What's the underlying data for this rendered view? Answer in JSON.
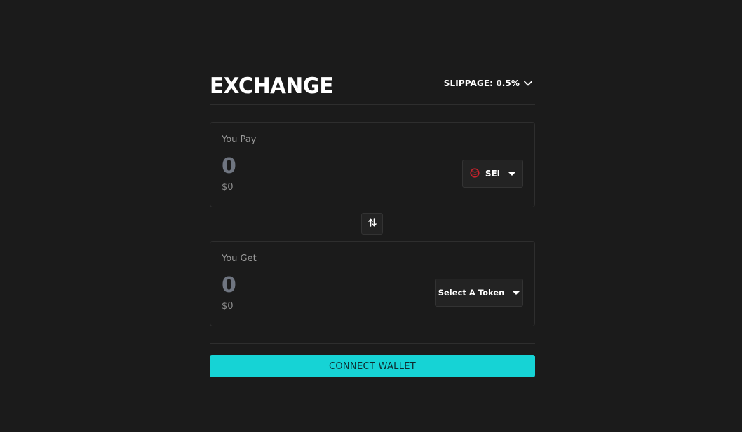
{
  "header": {
    "title": "EXCHANGE",
    "slippage_label": "SLIPPAGE: 0.5%"
  },
  "pay": {
    "label": "You Pay",
    "amount": "0",
    "usd": "$0",
    "token": "SEI",
    "token_icon": "sei-logo-icon",
    "token_icon_color": "#c8232c"
  },
  "get": {
    "label": "You Get",
    "amount": "0",
    "usd": "$0",
    "token": "Select A Token"
  },
  "swap_icon": "swap-arrows-icon",
  "connect_button": "CONNECT WALLET",
  "colors": {
    "background": "#1b1b1b",
    "accent": "#16d3d5",
    "border": "#2e2e2e",
    "amount_placeholder": "#6f7580"
  }
}
